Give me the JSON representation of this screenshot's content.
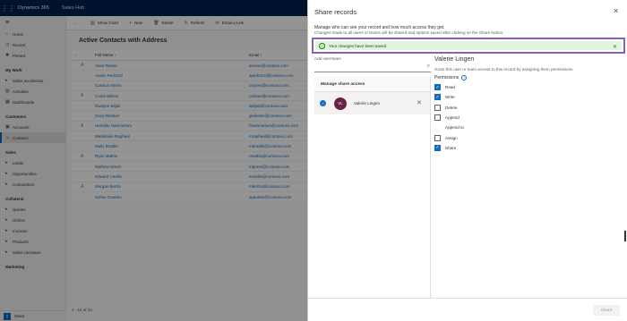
{
  "app": {
    "brand": "Dynamics 365",
    "app_name": "Sales Hub",
    "nav": {
      "top_items": [
        {
          "icon": "⌂",
          "label": "Home"
        },
        {
          "icon": "◷",
          "label": "Recent"
        },
        {
          "icon": "✱",
          "label": "Pinned"
        }
      ],
      "group_mywork": "My Work",
      "mywork_items": [
        {
          "icon": "▸",
          "label": "Sales accelerator"
        },
        {
          "icon": "▤",
          "label": "Activities"
        },
        {
          "icon": "▦",
          "label": "Dashboards"
        }
      ],
      "group_customers": "Customers",
      "customer_items": [
        {
          "icon": "▣",
          "label": "Accounts"
        },
        {
          "icon": "☺",
          "label": "Contacts"
        }
      ],
      "group_sales": "Sales",
      "sales_items": [
        {
          "icon": "▸",
          "label": "Leads"
        },
        {
          "icon": "▸",
          "label": "Opportunities"
        },
        {
          "icon": "▸",
          "label": "Competitors"
        }
      ],
      "group_collateral": "Collateral",
      "collateral_items": [
        {
          "icon": "▸",
          "label": "Quotes"
        },
        {
          "icon": "▸",
          "label": "Orders"
        },
        {
          "icon": "▸",
          "label": "Invoices"
        },
        {
          "icon": "▸",
          "label": "Products"
        },
        {
          "icon": "▸",
          "label": "Sales Literature"
        }
      ],
      "group_marketing": "Marketing",
      "area": {
        "initial": "S",
        "label": "Sales"
      }
    },
    "commands": [
      {
        "icon": "▥",
        "label": "Show Chart"
      },
      {
        "icon": "+",
        "label": "New"
      },
      {
        "icon": "🗑",
        "label": "Delete"
      },
      {
        "icon": "↻",
        "label": "Refresh"
      },
      {
        "icon": "✉",
        "label": "Email a Link"
      }
    ],
    "view_title": "Active Contacts with Address",
    "grid": {
      "col_name": "Full Name ↑",
      "col_email": "Email ↑",
      "rows": [
        {
          "name": "Anne Reese",
          "email": "areese@contoso.com"
        },
        {
          "name": "Anelio Pedrazzi",
          "email": "apedrazzi@contoso.com"
        },
        {
          "name": "Cassius Myers",
          "email": "cmyers@contoso.com"
        },
        {
          "name": "Cortis Wilson",
          "email": "cwilson@contoso.com"
        },
        {
          "name": "Dwayne Elijah",
          "email": "delijah@contoso.com"
        },
        {
          "name": "Greg Winston",
          "email": "gwinston@contoso.com"
        },
        {
          "name": "Hermilio Hammetum",
          "email": "hhammetum@contoso.com"
        },
        {
          "name": "Madelaine Rapheal",
          "email": "mrapheal@contoso.com"
        },
        {
          "name": "Molly Bradlin",
          "email": "mbradlin@contoso.com"
        },
        {
          "name": "Ryan Mathis",
          "email": "rmathis@contoso.com"
        },
        {
          "name": "Mathew Green",
          "email": "mgreen@contoso.com"
        },
        {
          "name": "Edward Ceville",
          "email": "eceville@contoso.com"
        },
        {
          "name": "Morgan Bertra",
          "email": "mbertra@contoso.com"
        },
        {
          "name": "Sohini Gautam",
          "email": "sgautam@contoso.com"
        }
      ],
      "footer": "1 - 14 of 14"
    }
  },
  "share_panel": {
    "title": "Share records",
    "description": "Manage who can see your record and how much access they get.",
    "note": "Changes made to all users or teams will be shared and options saved after clicking on the Share button.",
    "toast": "Your changes have been saved",
    "add_label": "Add user/team",
    "search_placeholder": "",
    "manage_heading": "Manage share access",
    "user": {
      "initials": "VL",
      "name": "Valerie Lingen"
    },
    "selected_name": "Valerie Lingen",
    "grant_text": "Grant this user or team access to this record by assigning them permissions",
    "permissions_label": "Permissions",
    "permissions": [
      {
        "label": "Read",
        "state": "on"
      },
      {
        "label": "Write",
        "state": "on"
      },
      {
        "label": "Delete",
        "state": "off"
      },
      {
        "label": "Append",
        "state": "off"
      },
      {
        "label": "Append to",
        "state": "none"
      },
      {
        "label": "Assign",
        "state": "off"
      },
      {
        "label": "Share",
        "state": "on"
      }
    ],
    "share_button": "Share"
  },
  "colors": {
    "topbar": "#002050",
    "accent": "#0f6cbd",
    "toast_bg": "#dff6dd",
    "toast_frame": "#8a5fb8",
    "avatar": "#6b2145"
  }
}
